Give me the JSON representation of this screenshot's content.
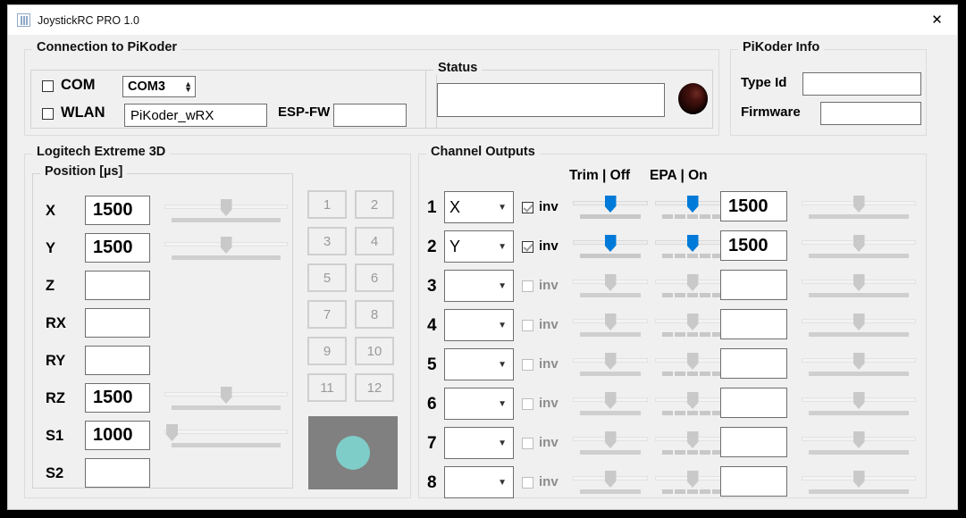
{
  "window": {
    "title": "JoystickRC PRO 1.0",
    "icon": "app-bars-icon",
    "close_label": "✕"
  },
  "connection": {
    "legend": "Connection to PiKoder",
    "com_label": "COM",
    "com_checked": false,
    "com_port": "COM3",
    "wlan_label": "WLAN",
    "wlan_checked": false,
    "wlan_ssid": "PiKoder_wRX",
    "espfw_label": "ESP-FW",
    "espfw_value": ""
  },
  "status": {
    "legend": "Status",
    "text": "",
    "led_state": "off",
    "led_color": "#2a0a08"
  },
  "pikoder_info": {
    "legend": "PiKoder Info",
    "type_id_label": "Type Id",
    "type_id_value": "",
    "firmware_label": "Firmware",
    "firmware_value": ""
  },
  "joystick": {
    "legend": "Logitech Extreme 3D",
    "position_legend": "Position [µs]",
    "axes": [
      {
        "name": "X",
        "value": "1500",
        "slider": true,
        "pos": 50
      },
      {
        "name": "Y",
        "value": "1500",
        "slider": true,
        "pos": 50
      },
      {
        "name": "Z",
        "value": "",
        "slider": false,
        "pos": 0
      },
      {
        "name": "RX",
        "value": "",
        "slider": false,
        "pos": 0
      },
      {
        "name": "RY",
        "value": "",
        "slider": false,
        "pos": 0
      },
      {
        "name": "RZ",
        "value": "1500",
        "slider": true,
        "pos": 50
      },
      {
        "name": "S1",
        "value": "1000",
        "slider": true,
        "pos": 0
      },
      {
        "name": "S2",
        "value": "",
        "slider": false,
        "pos": 0
      }
    ],
    "buttons": [
      "1",
      "2",
      "3",
      "4",
      "5",
      "6",
      "7",
      "8",
      "9",
      "10",
      "11",
      "12"
    ],
    "hat": {
      "dot_color": "#7fcdc8",
      "panel_color": "#808080"
    }
  },
  "channels": {
    "legend": "Channel Outputs",
    "trim_header": "Trim | Off",
    "epa_header": "EPA | On",
    "inv_label": "inv",
    "rows": [
      {
        "num": "1",
        "source": "X",
        "inv": true,
        "enabled": true,
        "trim": 50,
        "epa": 50,
        "value": "1500",
        "out": 50
      },
      {
        "num": "2",
        "source": "Y",
        "inv": true,
        "enabled": true,
        "trim": 50,
        "epa": 50,
        "value": "1500",
        "out": 50
      },
      {
        "num": "3",
        "source": "",
        "inv": false,
        "enabled": false,
        "trim": 50,
        "epa": 50,
        "value": "",
        "out": 50
      },
      {
        "num": "4",
        "source": "",
        "inv": false,
        "enabled": false,
        "trim": 50,
        "epa": 50,
        "value": "",
        "out": 50
      },
      {
        "num": "5",
        "source": "",
        "inv": false,
        "enabled": false,
        "trim": 50,
        "epa": 50,
        "value": "",
        "out": 50
      },
      {
        "num": "6",
        "source": "",
        "inv": false,
        "enabled": false,
        "trim": 50,
        "epa": 50,
        "value": "",
        "out": 50
      },
      {
        "num": "7",
        "source": "",
        "inv": false,
        "enabled": false,
        "trim": 50,
        "epa": 50,
        "value": "",
        "out": 50
      },
      {
        "num": "8",
        "source": "",
        "inv": false,
        "enabled": false,
        "trim": 50,
        "epa": 50,
        "value": "",
        "out": 50
      }
    ]
  },
  "colors": {
    "accent_blue": "#007ad9",
    "face": "#f0f0f0",
    "teal": "#7fcdc8"
  }
}
